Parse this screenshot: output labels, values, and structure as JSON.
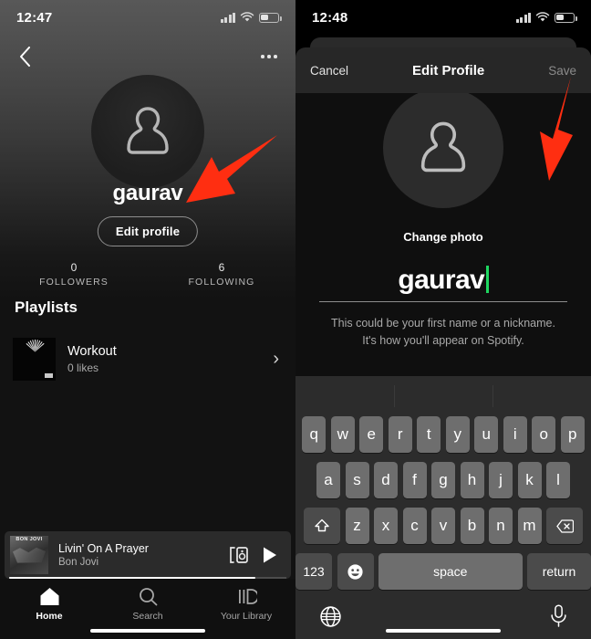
{
  "left": {
    "status": {
      "time": "12:47"
    },
    "nav": {
      "back": "‹",
      "more": "more-options"
    },
    "profile": {
      "name": "gaurav",
      "edit_button": "Edit profile",
      "stats": [
        {
          "num": "0",
          "label": "FOLLOWERS"
        },
        {
          "num": "6",
          "label": "FOLLOWING"
        }
      ]
    },
    "playlists": {
      "section_title": "Playlists",
      "items": [
        {
          "title": "Workout",
          "subtitle": "0 likes"
        }
      ]
    },
    "player": {
      "title": "Livin' On A Prayer",
      "artist": "Bon Jovi",
      "art_text": "BON JOVI"
    },
    "tabs": [
      {
        "label": "Home",
        "active": true
      },
      {
        "label": "Search",
        "active": false
      },
      {
        "label": "Your Library",
        "active": false
      }
    ]
  },
  "right": {
    "status": {
      "time": "12:48"
    },
    "modal": {
      "cancel": "Cancel",
      "title": "Edit Profile",
      "save": "Save",
      "change_photo": "Change photo",
      "name_value": "gaurav",
      "hint_line1": "This could be your first name or a nickname.",
      "hint_line2": "It's how you'll appear on Spotify."
    },
    "keyboard": {
      "row1": [
        "q",
        "w",
        "e",
        "r",
        "t",
        "y",
        "u",
        "i",
        "o",
        "p"
      ],
      "row2": [
        "a",
        "s",
        "d",
        "f",
        "g",
        "h",
        "j",
        "k",
        "l"
      ],
      "row3": [
        "z",
        "x",
        "c",
        "v",
        "b",
        "n",
        "m"
      ],
      "shift": "shift-key",
      "backspace": "backspace-key",
      "numbers": "123",
      "emoji": "emoji-key",
      "space": "space",
      "return": "return",
      "globe": "globe-key",
      "mic": "microphone-key"
    }
  },
  "annotations": {
    "arrow_color": "#FF2E11"
  }
}
